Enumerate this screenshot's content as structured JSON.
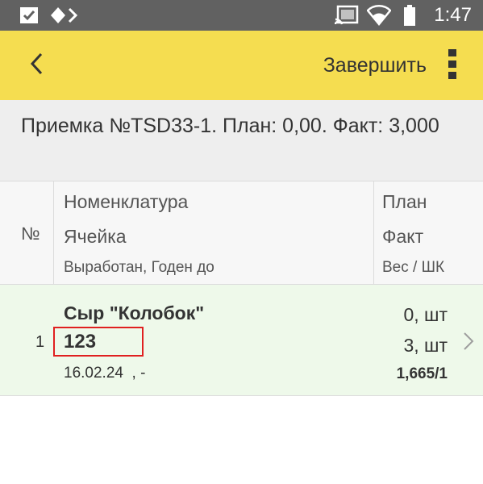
{
  "status_bar": {
    "time": "1:47",
    "icons": [
      "checkbox-notification-icon",
      "diamond-notification-icon",
      "cast-icon",
      "wifi-icon",
      "battery-icon"
    ]
  },
  "app_bar": {
    "back_icon": "chevron-left-icon",
    "finish_label": "Завершить",
    "more_icon": "more-vertical-icon"
  },
  "document": {
    "title": "Приемка №TSD33-1. План: 0,00. Факт: 3,000"
  },
  "table": {
    "headers": {
      "number": "№",
      "nomenclature": "Номенклатура",
      "cell": "Ячейка",
      "dates": "Выработан, Годен до",
      "plan": "План",
      "fact": "Факт",
      "weight": "Вес / ШК"
    },
    "rows": [
      {
        "number": "1",
        "name": "Сыр \"Колобок\"",
        "cell": "123",
        "dates": "16.02.24  , -",
        "plan": "0, шт",
        "fact": "3, шт",
        "weight": "1,665/1"
      }
    ]
  },
  "colors": {
    "status_bar": "#616161",
    "app_bar": "#f5dd50",
    "row_highlight": "#eef9ea",
    "cell_outline": "#e02020"
  }
}
